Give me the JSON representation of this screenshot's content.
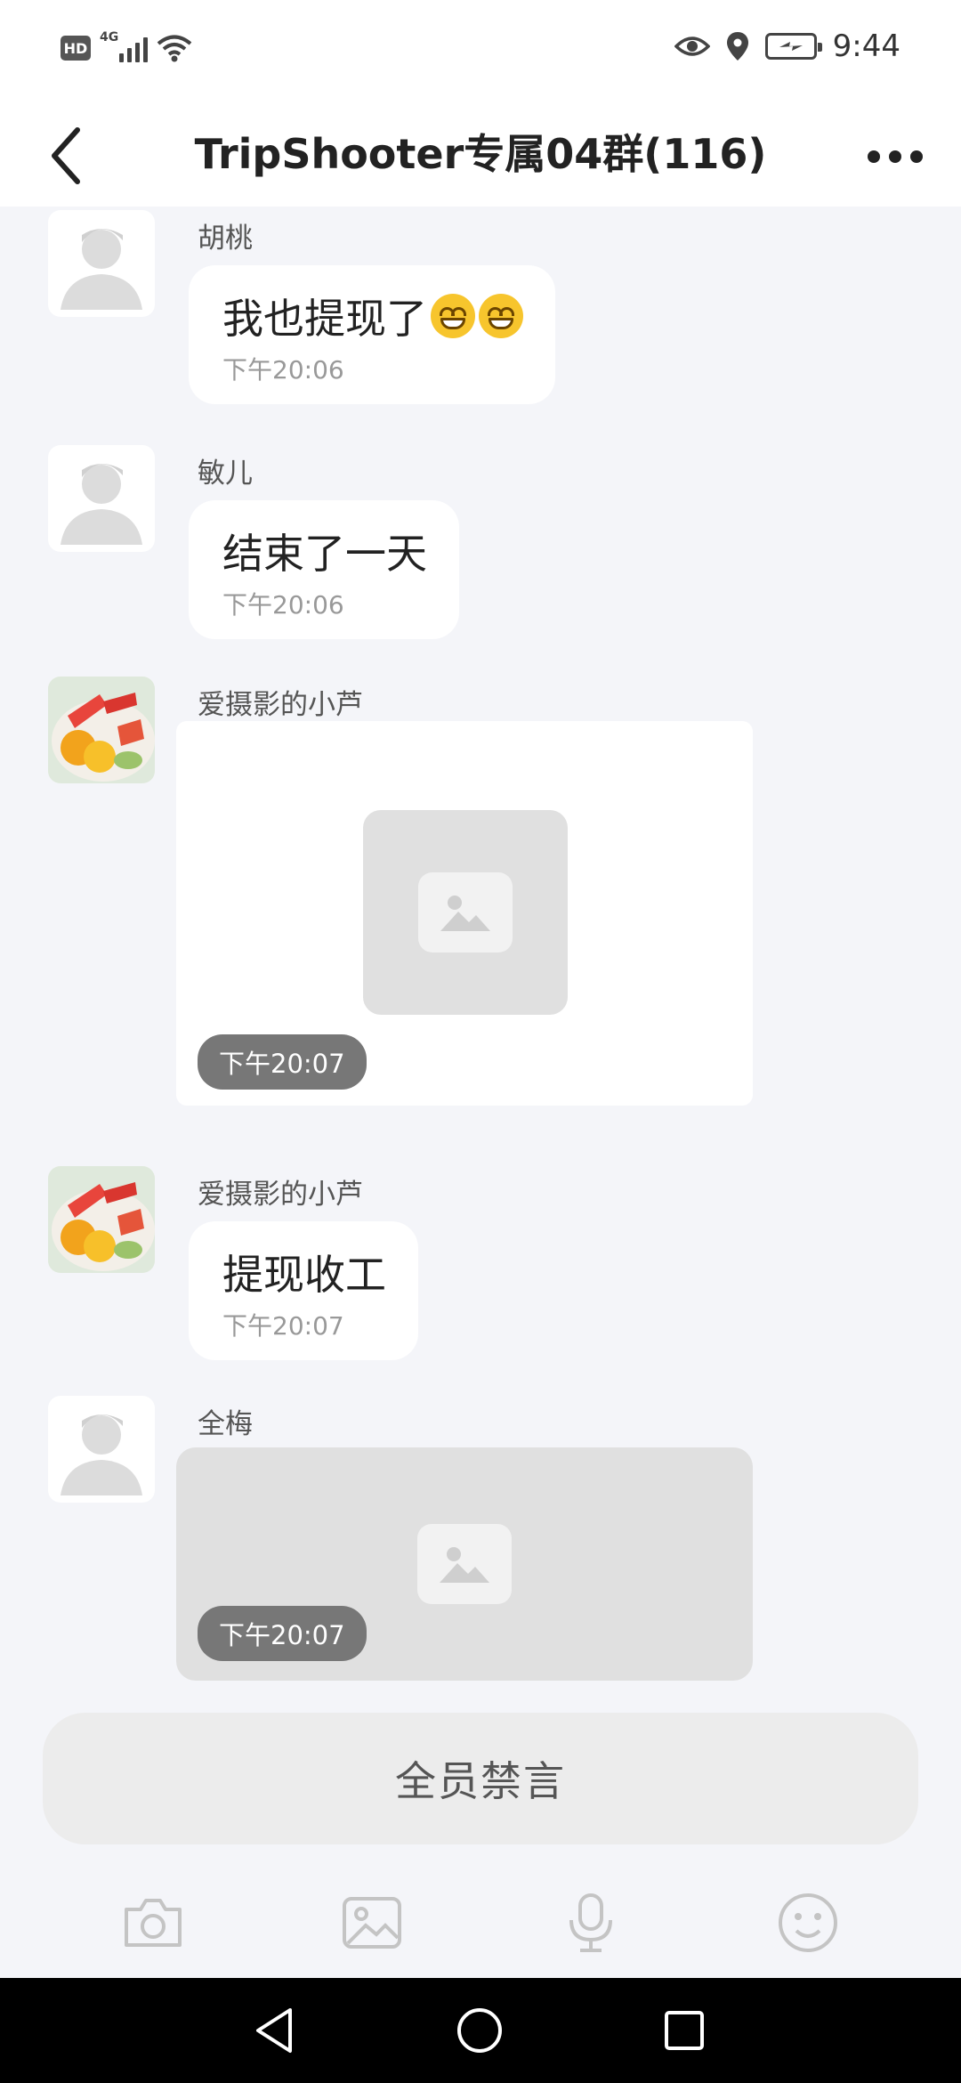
{
  "status_bar": {
    "hd_label": "HD",
    "network_label": "4G",
    "time": "9:44"
  },
  "header": {
    "title": "TripShooter专属04群(116)"
  },
  "messages": [
    {
      "sender": "胡桃",
      "text": "我也提现了",
      "time": "下午20:06",
      "avatar": "default-avatar-icon"
    },
    {
      "sender": "敏儿",
      "text": "结束了一天",
      "time": "下午20:06",
      "avatar": "default-avatar-icon"
    },
    {
      "sender": "爱摄影的小芦",
      "type": "image",
      "time": "下午20:07",
      "avatar": "fruit-photo"
    },
    {
      "sender": "爱摄影的小芦",
      "text": "提现收工",
      "time": "下午20:07",
      "avatar": "fruit-photo"
    },
    {
      "sender": "全梅",
      "type": "image",
      "time": "下午20:07",
      "avatar": "default-avatar-icon"
    }
  ],
  "mute_bar": {
    "label": "全员禁言"
  },
  "toolbar": {
    "items": [
      "camera-icon",
      "image-icon",
      "microphone-icon",
      "emoji-icon"
    ]
  },
  "colors": {
    "background": "#f4f5f9",
    "bubble": "#ffffff",
    "placeholder": "#e0e0e0",
    "time_pill": "#777777"
  }
}
